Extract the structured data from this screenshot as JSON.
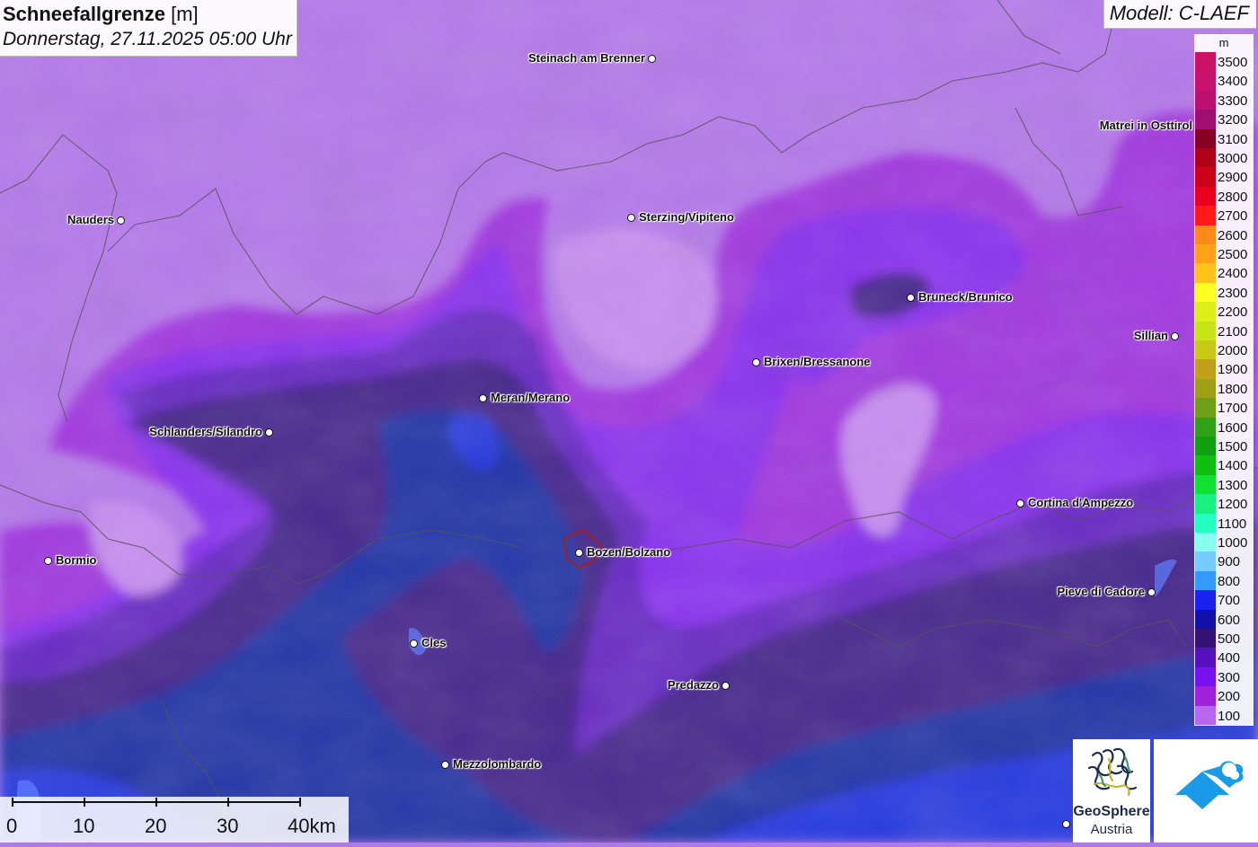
{
  "title": {
    "variable": "Schneefallgrenze",
    "unit": "[m]",
    "datetime": "Donnerstag, 27.11.2025 05:00 Uhr"
  },
  "model": "Modell: C-LAEF",
  "legend": {
    "unit": "m",
    "entries": [
      {
        "label": "3500",
        "color": "#cc1166"
      },
      {
        "label": "3400",
        "color": "#c8126e"
      },
      {
        "label": "3300",
        "color": "#bb1070"
      },
      {
        "label": "3200",
        "color": "#a00e70"
      },
      {
        "label": "3100",
        "color": "#880022"
      },
      {
        "label": "3000",
        "color": "#b00018"
      },
      {
        "label": "2900",
        "color": "#cc0018"
      },
      {
        "label": "2800",
        "color": "#e8001c"
      },
      {
        "label": "2700",
        "color": "#ff1a1a"
      },
      {
        "label": "2600",
        "color": "#ff8a1a"
      },
      {
        "label": "2500",
        "color": "#ffa21a"
      },
      {
        "label": "2400",
        "color": "#ffc21a"
      },
      {
        "label": "2300",
        "color": "#ffff22"
      },
      {
        "label": "2200",
        "color": "#ddf01a"
      },
      {
        "label": "2100",
        "color": "#c8e418"
      },
      {
        "label": "2000",
        "color": "#c8c818"
      },
      {
        "label": "1900",
        "color": "#c0a018"
      },
      {
        "label": "1800",
        "color": "#a0a018"
      },
      {
        "label": "1700",
        "color": "#70a018"
      },
      {
        "label": "1600",
        "color": "#30a018"
      },
      {
        "label": "1500",
        "color": "#10a010"
      },
      {
        "label": "1400",
        "color": "#10c010"
      },
      {
        "label": "1300",
        "color": "#10e030"
      },
      {
        "label": "1200",
        "color": "#18f080"
      },
      {
        "label": "1100",
        "color": "#22ffc0"
      },
      {
        "label": "1000",
        "color": "#88ffee"
      },
      {
        "label": "900",
        "color": "#77ccff"
      },
      {
        "label": "800",
        "color": "#3399ff"
      },
      {
        "label": "700",
        "color": "#1a22ee"
      },
      {
        "label": "600",
        "color": "#1111aa"
      },
      {
        "label": "500",
        "color": "#331177"
      },
      {
        "label": "400",
        "color": "#5511bb"
      },
      {
        "label": "300",
        "color": "#7711ee"
      },
      {
        "label": "200",
        "color": "#a022dd"
      },
      {
        "label": "100",
        "color": "#b866ee"
      }
    ]
  },
  "cities": [
    {
      "name": "Steinach am Brenner",
      "label_side": "left"
    },
    {
      "name": "Nauders",
      "label_side": "left"
    },
    {
      "name": "Sterzing/Vipiteno",
      "label_side": "right"
    },
    {
      "name": "Matrei in Osttirol",
      "label_side": "left"
    },
    {
      "name": "Bruneck/Brunico",
      "label_side": "right"
    },
    {
      "name": "Sillian",
      "label_side": "left"
    },
    {
      "name": "Brixen/Bressanone",
      "label_side": "right"
    },
    {
      "name": "Meran/Merano",
      "label_side": "right"
    },
    {
      "name": "Schlanders/Silandro",
      "label_side": "left"
    },
    {
      "name": "Cortina d'Ampezzo",
      "label_side": "right"
    },
    {
      "name": "Bormio",
      "label_side": "right"
    },
    {
      "name": "Bozen/Bolzano",
      "label_side": "right"
    },
    {
      "name": "Pieve di Cadore",
      "label_side": "left"
    },
    {
      "name": "Cles",
      "label_side": "right"
    },
    {
      "name": "Predazzo",
      "label_side": "left"
    },
    {
      "name": "Mezzolombardo",
      "label_side": "right"
    },
    {
      "name": "",
      "label_side": "none"
    }
  ],
  "scalebar": {
    "labels": [
      "0",
      "10",
      "20",
      "30",
      "40km"
    ]
  },
  "logos": {
    "geosphere_line1": "GeoSphere",
    "geosphere_line2": "Austria"
  }
}
